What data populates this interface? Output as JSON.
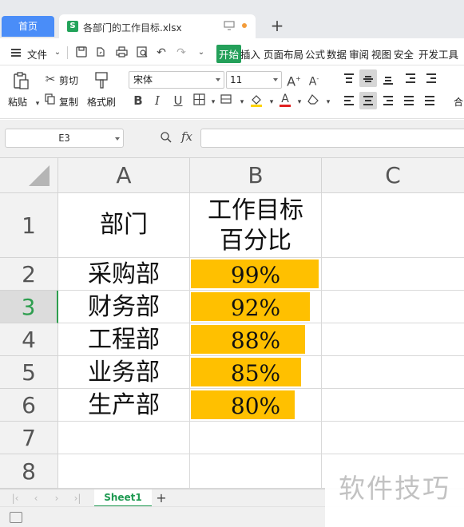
{
  "tabs": {
    "home_label": "首页",
    "file_label": "各部门的工作目标.xlsx",
    "file_icon_letter": "S"
  },
  "menu": {
    "file": "文件",
    "items": [
      "开始",
      "插入",
      "页面布局",
      "公式",
      "数据",
      "审阅",
      "视图",
      "安全",
      "开发工具"
    ]
  },
  "ribbon": {
    "paste": "粘贴",
    "cut": "剪切",
    "copy": "复制",
    "format_painter": "格式刷",
    "font_name": "宋体",
    "font_size": "11",
    "merge_partial": "合"
  },
  "formula_bar": {
    "name_box": "E3",
    "fx": "fx",
    "formula": ""
  },
  "columns": [
    "A",
    "B",
    "C"
  ],
  "rows": [
    "1",
    "2",
    "3",
    "4",
    "5",
    "6",
    "7",
    "8"
  ],
  "active_row": "3",
  "table": {
    "header_a": "部门",
    "header_b_line1": "工作目标",
    "header_b_line2": "百分比",
    "records": [
      {
        "dept": "采购部",
        "pct_text": "99%",
        "pct": 0.99
      },
      {
        "dept": "财务部",
        "pct_text": "92%",
        "pct": 0.92
      },
      {
        "dept": "工程部",
        "pct_text": "88%",
        "pct": 0.88
      },
      {
        "dept": "业务部",
        "pct_text": "85%",
        "pct": 0.85
      },
      {
        "dept": "生产部",
        "pct_text": "80%",
        "pct": 0.8
      }
    ],
    "databar_color": "#ffc000"
  },
  "sheets": [
    "Sheet1"
  ],
  "watermark": "软件技巧",
  "colors": {
    "accent_green": "#24a05a",
    "home_tab_blue": "#4a8df8"
  }
}
